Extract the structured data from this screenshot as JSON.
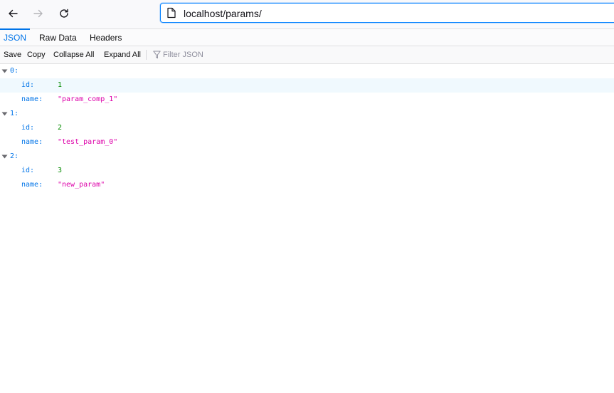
{
  "browser": {
    "url": "localhost/params/",
    "icons": {
      "back": "back-arrow-icon",
      "forward": "forward-arrow-icon",
      "reload": "reload-icon",
      "page": "page-icon"
    }
  },
  "viewer": {
    "tabs": [
      {
        "label": "JSON",
        "selected": true
      },
      {
        "label": "Raw Data",
        "selected": false
      },
      {
        "label": "Headers",
        "selected": false
      }
    ],
    "actions": {
      "save": "Save",
      "copy": "Copy",
      "collapse_all": "Collapse All",
      "expand_all": "Expand All",
      "filter_placeholder": "Filter JSON"
    },
    "colors": {
      "accent": "#0074e8",
      "key": "#0074e8",
      "number": "#058b00",
      "string": "#dd00a9"
    }
  },
  "json": {
    "items": [
      {
        "index": "0:",
        "id_key": "id:",
        "id": "1",
        "name_key": "name:",
        "name": "\"param_comp_1\""
      },
      {
        "index": "1:",
        "id_key": "id:",
        "id": "2",
        "name_key": "name:",
        "name": "\"test_param_0\""
      },
      {
        "index": "2:",
        "id_key": "id:",
        "id": "3",
        "name_key": "name:",
        "name": "\"new_param\""
      }
    ]
  }
}
